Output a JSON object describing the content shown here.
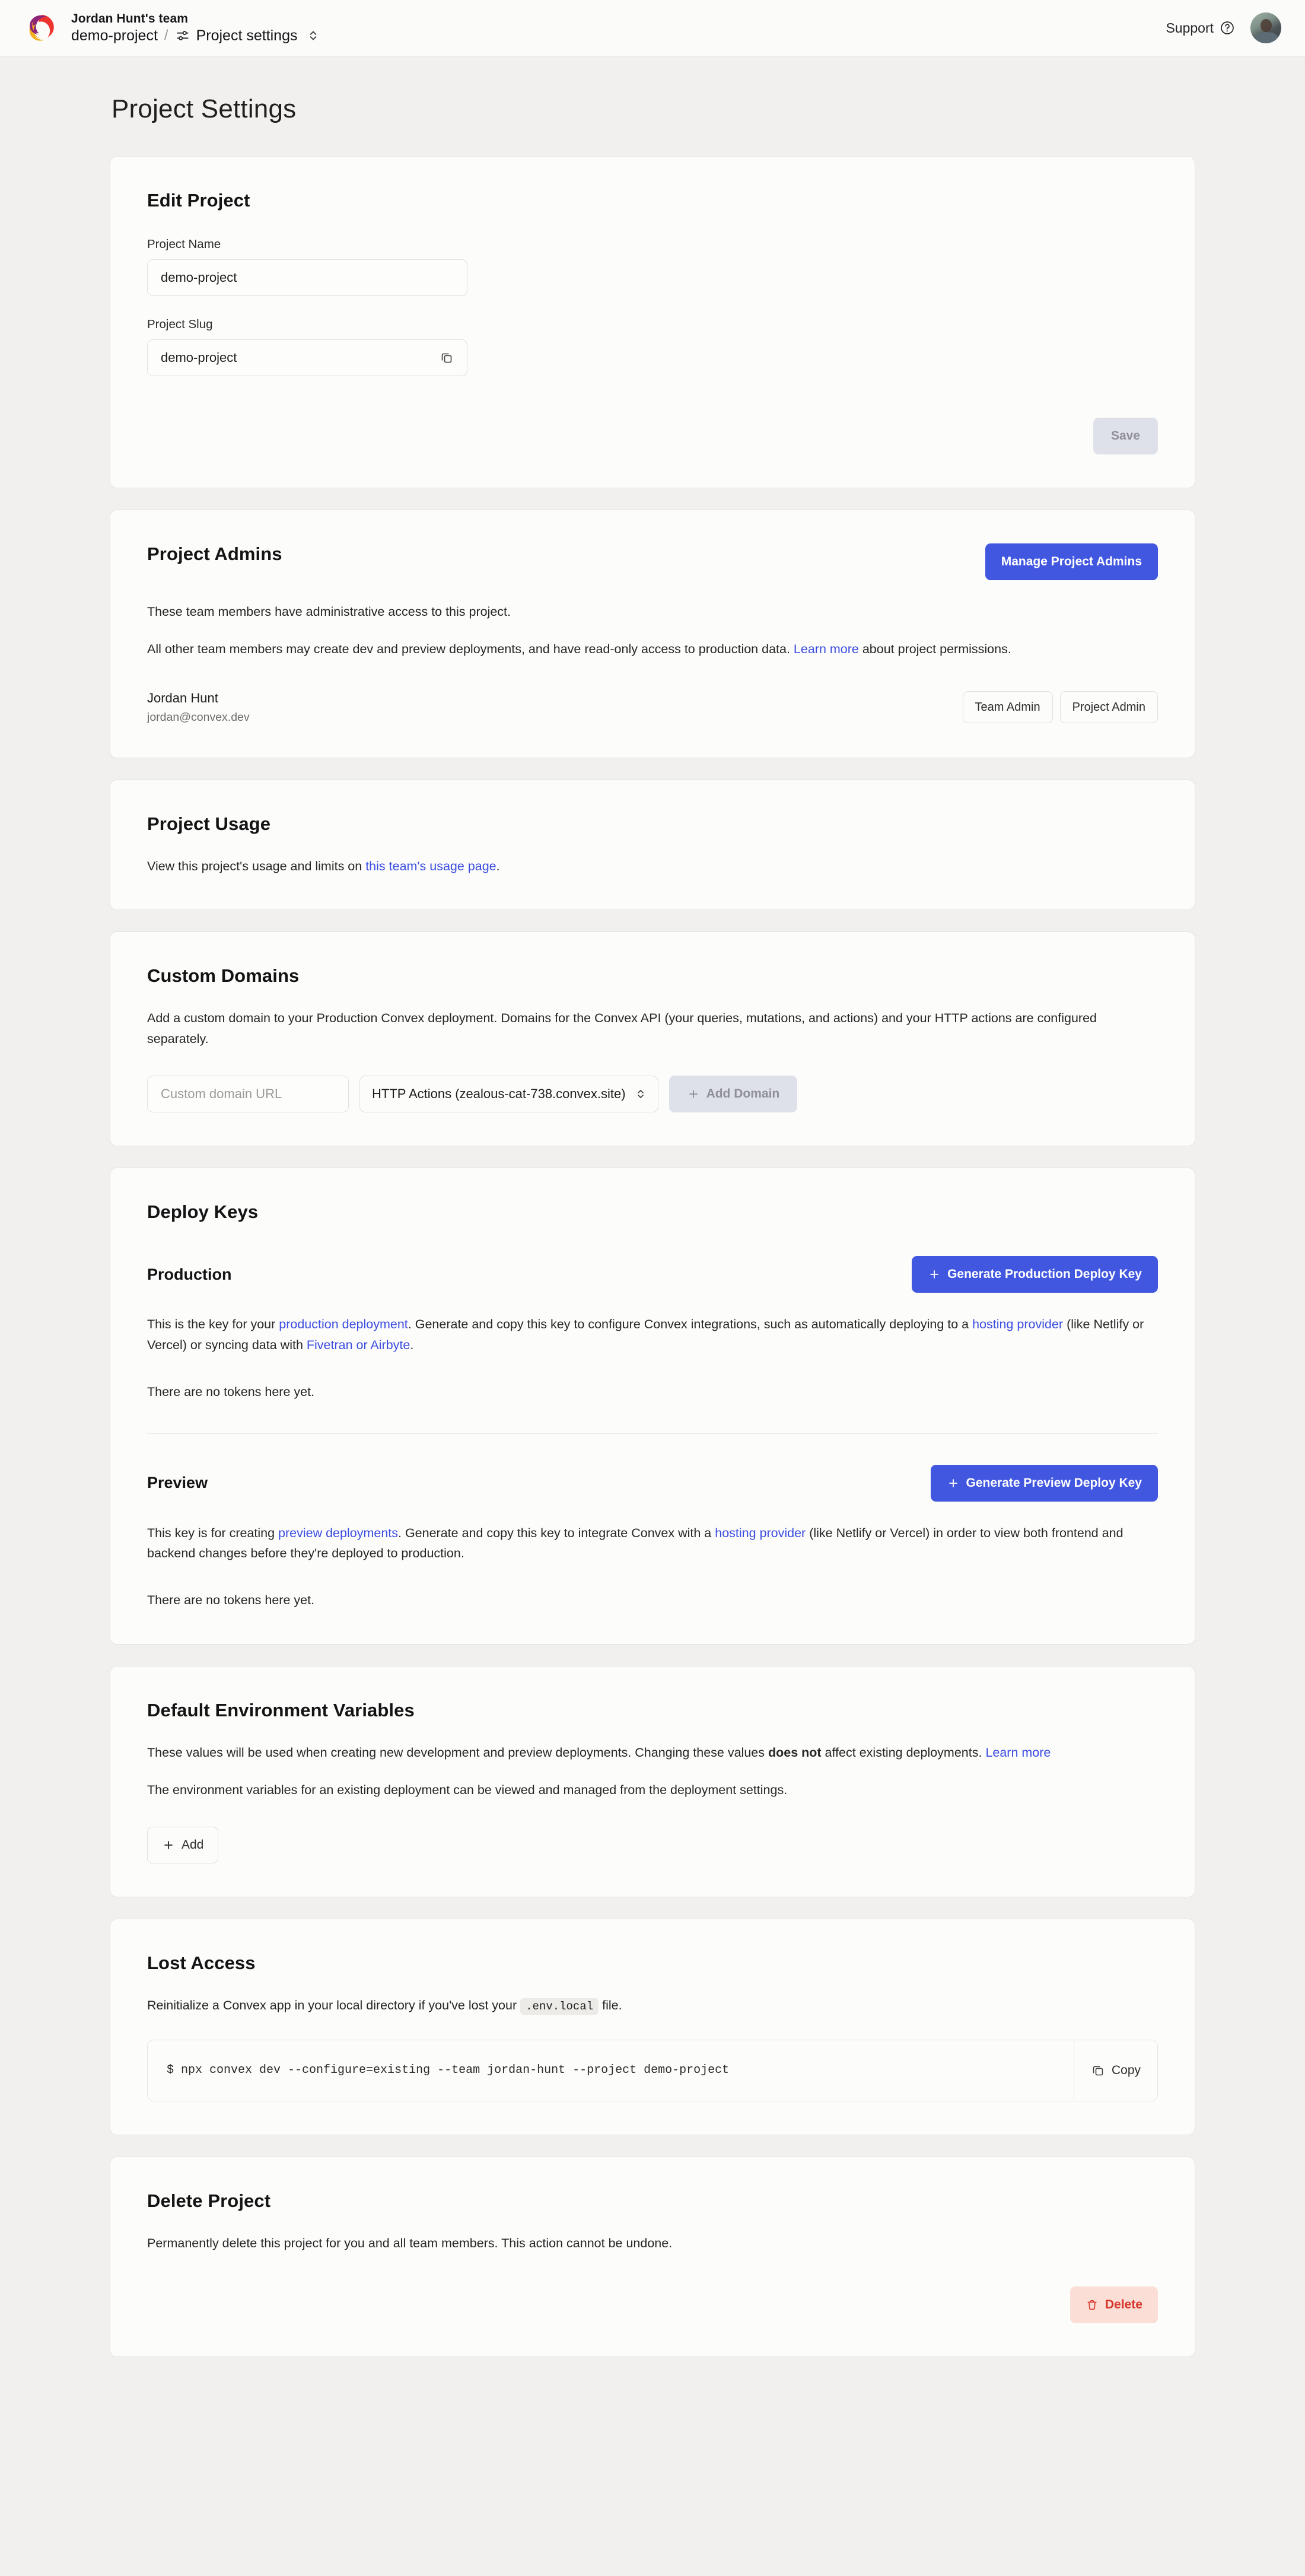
{
  "header": {
    "logo_icon": "convex-logo-icon",
    "team_name": "Jordan Hunt's team",
    "breadcrumb_project": "demo-project",
    "breadcrumb_separator": "/",
    "breadcrumb_settings_icon": "sliders-icon",
    "breadcrumb_current": "Project settings",
    "breadcrumb_chevron_icon": "chevron-up-down-icon",
    "support_label": "Support",
    "support_icon": "question-circle-icon",
    "avatar_name": "user-avatar"
  },
  "page": {
    "title": "Project Settings"
  },
  "edit_project": {
    "title": "Edit Project",
    "name_label": "Project Name",
    "name_value": "demo-project",
    "slug_label": "Project Slug",
    "slug_value": "demo-project",
    "copy_icon": "copy-icon",
    "save_label": "Save"
  },
  "project_admins": {
    "title": "Project Admins",
    "manage_button": "Manage Project Admins",
    "description_1": "These team members have administrative access to this project.",
    "description_2_pre": "All other team members may create dev and preview deployments, and have read-only access to production data. ",
    "description_2_link": "Learn more",
    "description_2_post": " about project permissions.",
    "member_name": "Jordan Hunt",
    "member_email": "jordan@convex.dev",
    "badge_team_admin": "Team Admin",
    "badge_project_admin": "Project Admin"
  },
  "project_usage": {
    "title": "Project Usage",
    "text_pre": "View this project's usage and limits on ",
    "link": "this team's usage page",
    "text_post": "."
  },
  "custom_domains": {
    "title": "Custom Domains",
    "description": "Add a custom domain to your Production Convex deployment. Domains for the Convex API (your queries, mutations, and actions) and your HTTP actions are configured separately.",
    "input_placeholder": "Custom domain URL",
    "select_value": "HTTP Actions (zealous-cat-738.convex.site)",
    "select_chevron_icon": "chevron-up-down-icon",
    "add_button": "Add Domain",
    "add_icon": "plus-icon"
  },
  "deploy_keys": {
    "title": "Deploy Keys",
    "production": {
      "heading": "Production",
      "button": "Generate Production Deploy Key",
      "button_icon": "plus-icon",
      "text_pre": "This is the key for your ",
      "link_1": "production deployment",
      "text_mid_1": ". Generate and copy this key to configure Convex integrations, such as automatically deploying to a ",
      "link_2": "hosting provider",
      "text_mid_2": " (like Netlify or Vercel) or syncing data with ",
      "link_3": "Fivetran or Airbyte",
      "text_post": ".",
      "empty": "There are no tokens here yet."
    },
    "preview": {
      "heading": "Preview",
      "button": "Generate Preview Deploy Key",
      "button_icon": "plus-icon",
      "text_pre": "This key is for creating ",
      "link_1": "preview deployments",
      "text_mid_1": ". Generate and copy this key to integrate Convex with a ",
      "link_2": "hosting provider",
      "text_post": " (like Netlify or Vercel) in order to view both frontend and backend changes before they're deployed to production.",
      "empty": "There are no tokens here yet."
    }
  },
  "default_env_vars": {
    "title": "Default Environment Variables",
    "description_pre": "These values will be used when creating new development and preview deployments. Changing these values ",
    "description_bold": "does not",
    "description_mid": " affect existing deployments. ",
    "description_link": "Learn more",
    "description_2": "The environment variables for an existing deployment can be viewed and managed from the deployment settings.",
    "add_button": "Add",
    "add_icon": "plus-icon"
  },
  "lost_access": {
    "title": "Lost Access",
    "text_pre": "Reinitialize a Convex app in your local directory if you've lost your ",
    "code": ".env.local",
    "text_post": " file.",
    "command": "$ npx convex dev --configure=existing --team jordan-hunt --project demo-project",
    "copy_label": "Copy",
    "copy_icon": "copy-icon"
  },
  "delete_project": {
    "title": "Delete Project",
    "description": "Permanently delete this project for you and all team members. This action cannot be undone.",
    "delete_label": "Delete",
    "delete_icon": "trash-icon"
  },
  "colors": {
    "accent": "#4157e0",
    "link": "#3b4de0",
    "danger_text": "#d5352a",
    "danger_bg": "#fbded6",
    "page_bg": "#f2f0ee",
    "card_bg": "#fcfcfb"
  }
}
